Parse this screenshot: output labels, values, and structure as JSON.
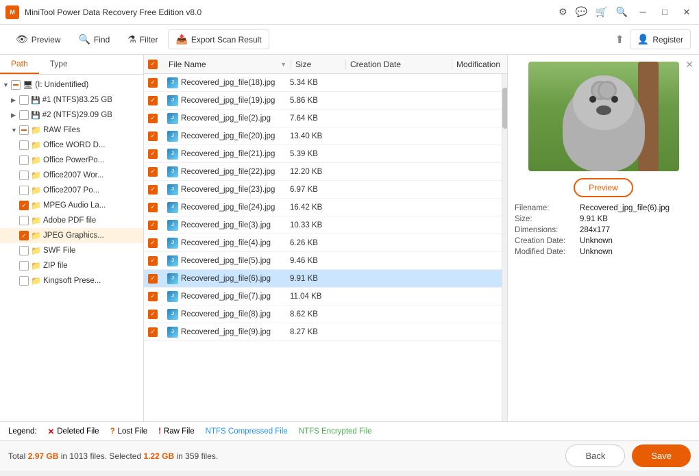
{
  "titlebar": {
    "title": "MiniTool Power Data Recovery Free Edition v8.0",
    "logo": "M"
  },
  "toolbar": {
    "preview_label": "Preview",
    "find_label": "Find",
    "filter_label": "Filter",
    "export_label": "Export Scan Result",
    "register_label": "Register"
  },
  "left_panel": {
    "tab_path": "Path",
    "tab_type": "Type",
    "tree": [
      {
        "id": "root",
        "label": "(I: Unidentified)",
        "indent": 0,
        "expand": true,
        "checked": "partial",
        "icon": "pc"
      },
      {
        "id": "ntfs1",
        "label": "#1 (NTFS)83.25 GB",
        "indent": 1,
        "expand": true,
        "checked": "unchecked",
        "icon": "drive"
      },
      {
        "id": "ntfs2",
        "label": "#2 (NTFS)29.09 GB",
        "indent": 1,
        "expand": false,
        "checked": "unchecked",
        "icon": "drive"
      },
      {
        "id": "raw",
        "label": "RAW Files",
        "indent": 1,
        "expand": true,
        "checked": "partial",
        "icon": "folder-orange"
      },
      {
        "id": "word",
        "label": "Office WORD D...",
        "indent": 2,
        "checked": "unchecked",
        "icon": "folder-orange"
      },
      {
        "id": "ppt",
        "label": "Office PowerPo...",
        "indent": 2,
        "checked": "unchecked",
        "icon": "folder-orange"
      },
      {
        "id": "word2",
        "label": "Office2007 Wor...",
        "indent": 2,
        "checked": "unchecked",
        "icon": "folder-orange"
      },
      {
        "id": "ppt2",
        "label": "Office2007 Po...",
        "indent": 2,
        "checked": "unchecked",
        "icon": "folder-orange"
      },
      {
        "id": "mpeg",
        "label": "MPEG Audio La...",
        "indent": 2,
        "checked": "checked",
        "icon": "folder-orange"
      },
      {
        "id": "pdf",
        "label": "Adobe PDF file",
        "indent": 2,
        "checked": "unchecked",
        "icon": "folder-orange"
      },
      {
        "id": "jpeg",
        "label": "JPEG Graphics...",
        "indent": 2,
        "checked": "checked",
        "icon": "folder-orange",
        "selected": true
      },
      {
        "id": "swf",
        "label": "SWF File",
        "indent": 2,
        "checked": "unchecked",
        "icon": "folder-orange"
      },
      {
        "id": "zip",
        "label": "ZIP file",
        "indent": 2,
        "checked": "unchecked",
        "icon": "folder-orange"
      },
      {
        "id": "king",
        "label": "Kingsoft Prese...",
        "indent": 2,
        "checked": "unchecked",
        "icon": "folder-orange"
      }
    ]
  },
  "file_list": {
    "headers": {
      "name": "File Name",
      "size": "Size",
      "date": "Creation Date",
      "mod": "Modification"
    },
    "files": [
      {
        "name": "Recovered_jpg_file(18).jpg",
        "size": "5.34 KB",
        "date": "",
        "mod": "",
        "checked": true
      },
      {
        "name": "Recovered_jpg_file(19).jpg",
        "size": "5.86 KB",
        "date": "",
        "mod": "",
        "checked": true
      },
      {
        "name": "Recovered_jpg_file(2).jpg",
        "size": "7.64 KB",
        "date": "",
        "mod": "",
        "checked": true
      },
      {
        "name": "Recovered_jpg_file(20).jpg",
        "size": "13.40 KB",
        "date": "",
        "mod": "",
        "checked": true
      },
      {
        "name": "Recovered_jpg_file(21).jpg",
        "size": "5.39 KB",
        "date": "",
        "mod": "",
        "checked": true
      },
      {
        "name": "Recovered_jpg_file(22).jpg",
        "size": "12.20 KB",
        "date": "",
        "mod": "",
        "checked": true
      },
      {
        "name": "Recovered_jpg_file(23).jpg",
        "size": "6.97 KB",
        "date": "",
        "mod": "",
        "checked": true
      },
      {
        "name": "Recovered_jpg_file(24).jpg",
        "size": "16.42 KB",
        "date": "",
        "mod": "",
        "checked": true
      },
      {
        "name": "Recovered_jpg_file(3).jpg",
        "size": "10.33 KB",
        "date": "",
        "mod": "",
        "checked": true
      },
      {
        "name": "Recovered_jpg_file(4).jpg",
        "size": "6.26 KB",
        "date": "",
        "mod": "",
        "checked": true
      },
      {
        "name": "Recovered_jpg_file(5).jpg",
        "size": "9.46 KB",
        "date": "",
        "mod": "",
        "checked": true
      },
      {
        "name": "Recovered_jpg_file(6).jpg",
        "size": "9.91 KB",
        "date": "",
        "mod": "",
        "checked": true,
        "selected": true
      },
      {
        "name": "Recovered_jpg_file(7).jpg",
        "size": "11.04 KB",
        "date": "",
        "mod": "",
        "checked": true
      },
      {
        "name": "Recovered_jpg_file(8).jpg",
        "size": "8.62 KB",
        "date": "",
        "mod": "",
        "checked": true
      },
      {
        "name": "Recovered_jpg_file(9).jpg",
        "size": "8.27 KB",
        "date": "",
        "mod": "",
        "checked": true
      }
    ]
  },
  "preview": {
    "button_label": "Preview",
    "filename_label": "Filename:",
    "size_label": "Size:",
    "dimensions_label": "Dimensions:",
    "creation_label": "Creation Date:",
    "modified_label": "Modified Date:",
    "filename_value": "Recovered_jpg_file(6).jpg",
    "size_value": "9.91 KB",
    "dimensions_value": "284x177",
    "creation_value": "Unknown",
    "modified_value": "Unknown"
  },
  "legend": {
    "deleted_label": "Deleted File",
    "lost_label": "Lost File",
    "raw_label": "Raw File",
    "ntfs1_label": "NTFS Compressed File",
    "ntfs2_label": "NTFS Encrypted File"
  },
  "status": {
    "text_prefix": "Total ",
    "total_size": "2.97 GB",
    "text_mid": " in 1013 files.  Selected ",
    "selected_size": "1.22 GB",
    "text_suffix": " in 359 files.",
    "back_label": "Back",
    "save_label": "Save"
  }
}
